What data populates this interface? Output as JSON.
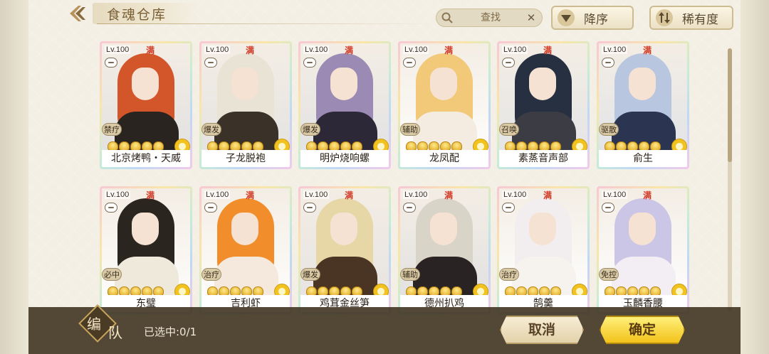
{
  "header": {
    "title": "食魂仓库",
    "search_placeholder": "查找",
    "sort_order_label": "降序",
    "sort_rarity_label": "稀有度"
  },
  "cards": [
    {
      "level": "Lv.100",
      "max": "满",
      "role": "禁疗",
      "name": "北京烤鸭・天威",
      "hair": "#d2562a",
      "outfit": "#2a2420"
    },
    {
      "level": "Lv.100",
      "max": "满",
      "role": "爆发",
      "name": "子龙脱袍",
      "hair": "#e9e3d6",
      "outfit": "#3a3128"
    },
    {
      "level": "Lv.100",
      "max": "满",
      "role": "爆发",
      "name": "明炉烧响螺",
      "hair": "#9a8ab4",
      "outfit": "#2d2838"
    },
    {
      "level": "Lv.100",
      "max": "满",
      "role": "辅助",
      "name": "龙凤配",
      "hair": "#f1c978",
      "outfit": "#f4ece0"
    },
    {
      "level": "Lv.100",
      "max": "满",
      "role": "召唤",
      "name": "素蒸音声部",
      "hair": "#263041",
      "outfit": "#3c3c44"
    },
    {
      "level": "Lv.100",
      "max": "满",
      "role": "驱散",
      "name": "俞生",
      "hair": "#b9c6e0",
      "outfit": "#2b3552"
    },
    {
      "level": "Lv.100",
      "max": "满",
      "role": "必中",
      "name": "东璧",
      "hair": "#2b2520",
      "outfit": "#efe9dc"
    },
    {
      "level": "Lv.100",
      "max": "满",
      "role": "治疗",
      "name": "吉利虾",
      "hair": "#f28d2c",
      "outfit": "#f4e9dc"
    },
    {
      "level": "Lv.100",
      "max": "满",
      "role": "爆发",
      "name": "鸡茸金丝笋",
      "hair": "#e7d6a6",
      "outfit": "#4a3424"
    },
    {
      "level": "Lv.100",
      "max": "满",
      "role": "辅助",
      "name": "德州扒鸡",
      "hair": "#d9d4c8",
      "outfit": "#2a2324"
    },
    {
      "level": "Lv.100",
      "max": "满",
      "role": "治疗",
      "name": "鹄羹",
      "hair": "#f2eef0",
      "outfit": "#f6f2ee"
    },
    {
      "level": "Lv.100",
      "max": "满",
      "role": "免控",
      "name": "玉麟香腰",
      "hair": "#cbc6e6",
      "outfit": "#f2eef4"
    }
  ],
  "footer": {
    "team_char1": "编",
    "team_char2": "队",
    "selected_text": "已选中:0/1",
    "cancel_label": "取消",
    "confirm_label": "确定"
  }
}
